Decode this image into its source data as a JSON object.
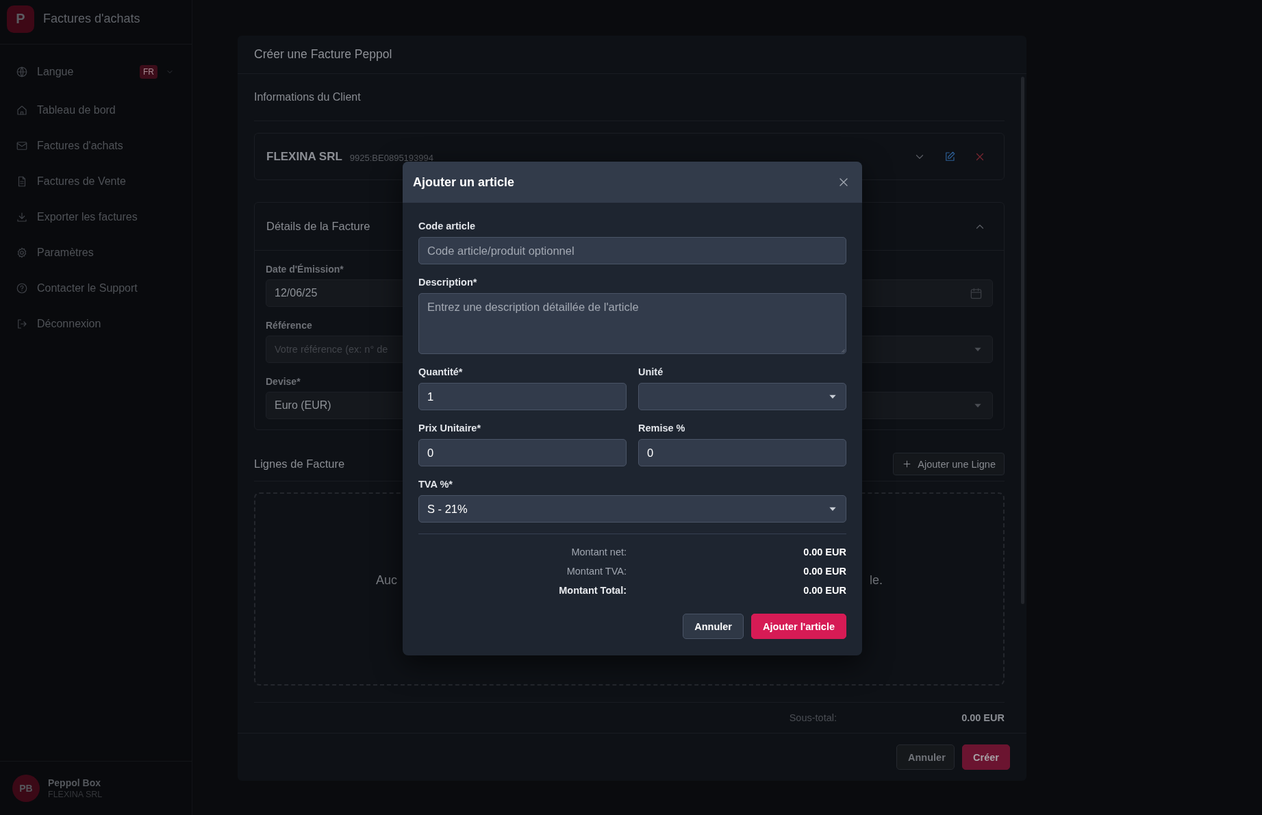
{
  "sidebar": {
    "logo": "P",
    "title": "Factures d'achats",
    "language": {
      "label": "Langue",
      "badge": "FR"
    },
    "items": [
      "Tableau de bord",
      "Factures d'achats",
      "Factures de Vente",
      "Exporter les factures",
      "Paramètres",
      "Contacter le Support",
      "Déconnexion"
    ],
    "user": {
      "initials": "PB",
      "name": "Peppol Box",
      "company": "FLEXINA SRL"
    }
  },
  "invoice_dialog": {
    "title": "Créer une Facture Peppol",
    "client": {
      "heading": "Informations du Client",
      "name": "FLEXINA SRL",
      "identifier": "9925:BE0895193994"
    },
    "details": {
      "heading": "Détails de la Facture",
      "expanded": true,
      "rows": [
        [
          {
            "kind": "input",
            "label": "Date d'Émission*",
            "value": "12/06/25"
          },
          {
            "kind": "date"
          }
        ],
        [
          {
            "kind": "input",
            "label": "Référence",
            "placeholder": "Votre référence (ex: n° de"
          },
          {
            "kind": "select"
          }
        ],
        [
          {
            "kind": "input",
            "label": "Devise*",
            "value": "Euro (EUR)"
          },
          {
            "kind": "select"
          }
        ]
      ]
    },
    "lines": {
      "heading": "Lignes de Facture",
      "add_button": "Ajouter une Ligne",
      "empty_message": [
        "Auc",
        "le."
      ]
    },
    "subtotal": {
      "label": "Sous-total:",
      "value": "0.00 EUR"
    },
    "buttons": [
      {
        "label": "Annuler",
        "kind": "secondary"
      },
      {
        "label": "Créer",
        "kind": "primary"
      }
    ]
  },
  "add_item_modal": {
    "title": "Ajouter un article",
    "rows": [
      [
        {
          "kind": "input",
          "label": "Code article",
          "placeholder": "Code article/produit optionnel"
        }
      ],
      [
        {
          "kind": "textarea",
          "label": "Description*",
          "placeholder": "Entrez une description détaillée de l'article"
        }
      ],
      [
        {
          "kind": "input",
          "label": "Quantité*",
          "value": "1"
        },
        {
          "kind": "select",
          "label": "Unité"
        }
      ],
      [
        {
          "kind": "input",
          "label": "Prix Unitaire*",
          "value": "0"
        },
        {
          "kind": "input",
          "label": "Remise %",
          "value": "0"
        }
      ],
      [
        {
          "kind": "select",
          "label": "TVA %*",
          "value": "S - 21%"
        }
      ]
    ],
    "totals": [
      {
        "label": "Montant net:",
        "value": "0.00 EUR",
        "emphasis": false
      },
      {
        "label": "Montant TVA:",
        "value": "0.00 EUR",
        "emphasis": false
      },
      {
        "label": "Montant Total:",
        "value": "0.00 EUR",
        "emphasis": true
      }
    ],
    "buttons": [
      {
        "label": "Annuler",
        "kind": "secondary"
      },
      {
        "label": "Ajouter l'article",
        "kind": "primary"
      }
    ]
  }
}
